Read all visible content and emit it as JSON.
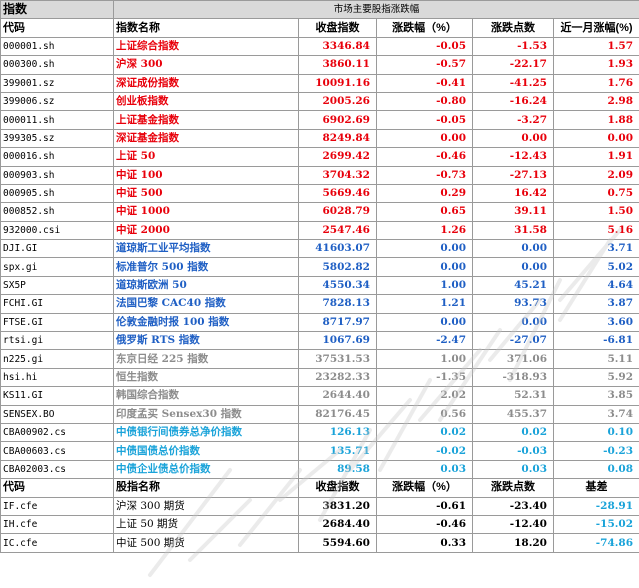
{
  "title": "市场主要股指涨跌幅",
  "corner_label": "指数",
  "headers": [
    "代码",
    "指数名称",
    "收盘指数",
    "涨跌幅（%）",
    "涨跌点数",
    "近一月涨幅(%)"
  ],
  "rows": [
    {
      "code": "000001.sh",
      "name": "上证综合指数",
      "close": "3346.84",
      "pct": "-0.05",
      "pts": "-1.53",
      "month": "1.57",
      "color": "red"
    },
    {
      "code": "000300.sh",
      "name": "沪深 300",
      "close": "3860.11",
      "pct": "-0.57",
      "pts": "-22.17",
      "month": "1.93",
      "color": "red"
    },
    {
      "code": "399001.sz",
      "name": "深证成份指数",
      "close": "10091.16",
      "pct": "-0.41",
      "pts": "-41.25",
      "month": "1.76",
      "color": "red"
    },
    {
      "code": "399006.sz",
      "name": "创业板指数",
      "close": "2005.26",
      "pct": "-0.80",
      "pts": "-16.24",
      "month": "2.98",
      "color": "red"
    },
    {
      "code": "000011.sh",
      "name": "上证基金指数",
      "close": "6902.69",
      "pct": "-0.05",
      "pts": "-3.27",
      "month": "1.88",
      "color": "red"
    },
    {
      "code": "399305.sz",
      "name": "深证基金指数",
      "close": "8249.84",
      "pct": "0.00",
      "pts": "0.00",
      "month": "0.00",
      "color": "red"
    },
    {
      "code": "000016.sh",
      "name": "上证 50",
      "close": "2699.42",
      "pct": "-0.46",
      "pts": "-12.43",
      "month": "1.91",
      "color": "red"
    },
    {
      "code": "000903.sh",
      "name": "中证 100",
      "close": "3704.32",
      "pct": "-0.73",
      "pts": "-27.13",
      "month": "2.09",
      "color": "red"
    },
    {
      "code": "000905.sh",
      "name": "中证 500",
      "close": "5669.46",
      "pct": "0.29",
      "pts": "16.42",
      "month": "0.75",
      "color": "red"
    },
    {
      "code": "000852.sh",
      "name": "中证 1000",
      "close": "6028.79",
      "pct": "0.65",
      "pts": "39.11",
      "month": "1.50",
      "color": "red"
    },
    {
      "code": "932000.csi",
      "name": "中证 2000",
      "close": "2547.46",
      "pct": "1.26",
      "pts": "31.58",
      "month": "5.16",
      "color": "red"
    },
    {
      "code": "DJI.GI",
      "name": "道琼斯工业平均指数",
      "close": "41603.07",
      "pct": "0.00",
      "pts": "0.00",
      "month": "3.71",
      "color": "blue"
    },
    {
      "code": "spx.gi",
      "name": "标准普尔 500 指数",
      "close": "5802.82",
      "pct": "0.00",
      "pts": "0.00",
      "month": "5.02",
      "color": "blue"
    },
    {
      "code": "SX5P",
      "name": "道琼斯欧洲 50",
      "close": "4550.34",
      "pct": "1.00",
      "pts": "45.21",
      "month": "4.64",
      "color": "blue"
    },
    {
      "code": "FCHI.GI",
      "name": "法国巴黎 CAC40 指数",
      "close": "7828.13",
      "pct": "1.21",
      "pts": "93.73",
      "month": "3.87",
      "color": "blue"
    },
    {
      "code": "FTSE.GI",
      "name": "伦敦金融时报 100 指数",
      "close": "8717.97",
      "pct": "0.00",
      "pts": "0.00",
      "month": "3.60",
      "color": "blue"
    },
    {
      "code": "rtsi.gi",
      "name": "俄罗斯 RTS 指数",
      "close": "1067.69",
      "pct": "-2.47",
      "pts": "-27.07",
      "month": "-6.81",
      "color": "blue"
    },
    {
      "code": "n225.gi",
      "name": "东京日经 225 指数",
      "close": "37531.53",
      "pct": "1.00",
      "pts": "371.06",
      "month": "5.11",
      "color": "gray"
    },
    {
      "code": "hsi.hi",
      "name": "恒生指数",
      "close": "23282.33",
      "pct": "-1.35",
      "pts": "-318.93",
      "month": "5.92",
      "color": "gray"
    },
    {
      "code": "KS11.GI",
      "name": "韩国综合指数",
      "close": "2644.40",
      "pct": "2.02",
      "pts": "52.31",
      "month": "3.85",
      "color": "gray"
    },
    {
      "code": "SENSEX.BO",
      "name": "印度孟买 Sensex30 指数",
      "close": "82176.45",
      "pct": "0.56",
      "pts": "455.37",
      "month": "3.74",
      "color": "gray"
    },
    {
      "code": "CBA00902.cs",
      "name": "中债银行间债券总净价指数",
      "close": "126.13",
      "pct": "0.02",
      "pts": "0.02",
      "month": "0.10",
      "color": "cyan"
    },
    {
      "code": "CBA00603.cs",
      "name": "中债国债总价指数",
      "close": "135.71",
      "pct": "-0.02",
      "pts": "-0.03",
      "month": "-0.23",
      "color": "cyan"
    },
    {
      "code": "CBA02003.cs",
      "name": "中债企业债总价指数",
      "close": "89.58",
      "pct": "0.03",
      "pts": "0.03",
      "month": "0.08",
      "color": "cyan"
    }
  ],
  "futures_headers": [
    "代码",
    "股指名称",
    "收盘指数",
    "涨跌幅（%）",
    "涨跌点数",
    "基差"
  ],
  "futures": [
    {
      "code": "IF.cfe",
      "name": "沪深 300 期货",
      "close": "3831.20",
      "pct": "-0.61",
      "pts": "-23.40",
      "basis": "-28.91"
    },
    {
      "code": "IH.cfe",
      "name": "上证 50 期货",
      "close": "2684.40",
      "pct": "-0.46",
      "pts": "-12.40",
      "basis": "-15.02"
    },
    {
      "code": "IC.cfe",
      "name": "中证 500 期货",
      "close": "5594.60",
      "pct": "0.33",
      "pts": "18.20",
      "basis": "-74.86"
    }
  ],
  "colors": {
    "red": "#e8000b",
    "blue": "#1f5fc4",
    "gray": "#8c8c8c",
    "cyan": "#1aa3d9",
    "header_bg": "#d9d9d9"
  }
}
